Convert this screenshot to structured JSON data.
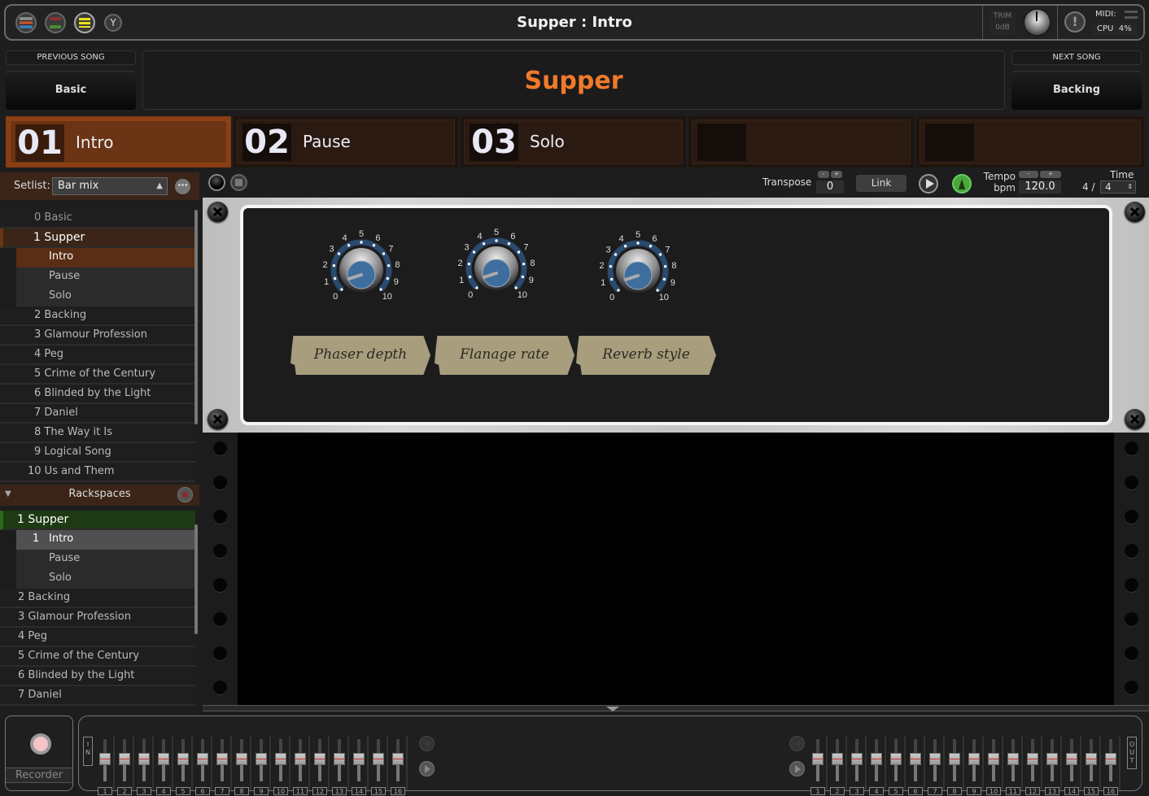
{
  "titlebar": {
    "title": "Supper : Intro",
    "icons": [
      "rackspace-view-icon",
      "wiring-view-icon",
      "setlist-view-icon",
      "tuner-icon"
    ],
    "trim_label": "TRIM",
    "trim_value": "0dB",
    "midi_label": "MIDI:",
    "cpu_label": "CPU",
    "cpu_value": "4%"
  },
  "songs": {
    "previous_label": "PREVIOUS SONG",
    "previous_name": "Basic",
    "current_name": "Supper",
    "next_label": "NEXT SONG",
    "next_name": "Backing"
  },
  "parts": [
    {
      "num": "01",
      "name": "Intro",
      "active": true
    },
    {
      "num": "02",
      "name": "Pause",
      "active": false
    },
    {
      "num": "03",
      "name": "Solo",
      "active": false
    },
    {
      "num": "",
      "name": "",
      "active": false
    },
    {
      "num": "",
      "name": "",
      "active": false
    }
  ],
  "setlist": {
    "label": "Setlist:",
    "selected": "Bar mix",
    "songs": [
      {
        "label": "0 Basic"
      },
      {
        "label": "1 Supper",
        "active": true,
        "parts": [
          "Intro",
          "Pause",
          "Solo"
        ],
        "selected_part": 0
      },
      {
        "label": "2 Backing"
      },
      {
        "label": "3 Glamour Profession"
      },
      {
        "label": "4 Peg"
      },
      {
        "label": "5 Crime of the Century"
      },
      {
        "label": "6 Blinded by the Light"
      },
      {
        "label": "7 Daniel"
      },
      {
        "label": "8 The Way it Is"
      },
      {
        "label": "9 Logical Song"
      },
      {
        "label": "10 Us and Them"
      }
    ]
  },
  "rackspaces": {
    "header": "Rackspaces",
    "items": [
      {
        "label": "1 Supper",
        "active": true,
        "variations": [
          {
            "num": "1",
            "name": "Intro"
          },
          {
            "num": "",
            "name": "Pause"
          },
          {
            "num": "",
            "name": "Solo"
          }
        ]
      },
      {
        "label": "2 Backing"
      },
      {
        "label": "3 Glamour Profession"
      },
      {
        "label": "4 Peg"
      },
      {
        "label": "5 Crime of the Century"
      },
      {
        "label": "6 Blinded by the Light"
      },
      {
        "label": "7 Daniel"
      }
    ]
  },
  "toolbar": {
    "transpose_label": "Transpose",
    "transpose_value": "0",
    "minus": "-",
    "plus": "+",
    "link_label": "Link",
    "tempo_label": "Tempo",
    "bpm_label": "bpm",
    "tempo_value": "120.0",
    "time_label": "Time",
    "time_numerator": "4 /",
    "time_denominator": "4"
  },
  "panel": {
    "knobs": [
      {
        "name": "Phaser depth",
        "value": 1.0
      },
      {
        "name": "Flanage rate",
        "value": 1.0
      },
      {
        "name": "Reverb style",
        "value": 1.0
      }
    ],
    "scale": [
      "0",
      "1",
      "2",
      "3",
      "4",
      "5",
      "6",
      "7",
      "8",
      "9",
      "10"
    ]
  },
  "bottom": {
    "recorder_label": "Recorder",
    "in_label": "I N",
    "out_label": "O U T",
    "input_channels": [
      "1",
      "2",
      "3",
      "4",
      "5",
      "6",
      "7",
      "8",
      "9",
      "10",
      "11",
      "12",
      "13",
      "14",
      "15",
      "16"
    ],
    "output_channels": [
      "1",
      "2",
      "3",
      "4",
      "5",
      "6",
      "7",
      "8",
      "9",
      "10",
      "11",
      "12",
      "13",
      "14",
      "15",
      "16"
    ],
    "fader_level": 0.6
  }
}
